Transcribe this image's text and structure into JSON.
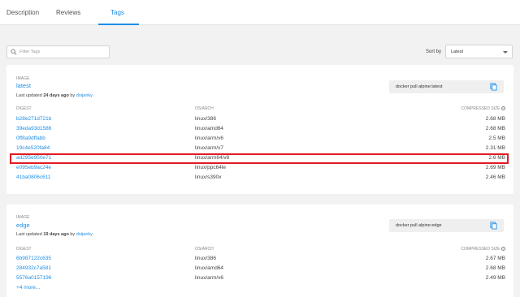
{
  "tabs": [
    {
      "label": "Description"
    },
    {
      "label": "Reviews"
    },
    {
      "label": "Tags"
    }
  ],
  "filter": {
    "placeholder": "Filter Tags",
    "value": ""
  },
  "sort": {
    "label": "Sort by",
    "selected": "Latest"
  },
  "columns": {
    "digest": "DIGEST",
    "os_arch": "OS/ARCH",
    "size": "COMPRESSED SIZE"
  },
  "help_glyph": "?",
  "cards": [
    {
      "image_label": "IMAGE",
      "tag": "latest",
      "updated_prefix": "Last updated",
      "updated_ago": "24 days ago",
      "updated_by": "by",
      "user": "doijanky",
      "pull_command": "docker pull alpine:latest",
      "rows": [
        {
          "digest": "b28e271d721b",
          "arch": "linux/386",
          "size": "2.68 MB"
        },
        {
          "digest": "39eda93d1586",
          "arch": "linux/amd64",
          "size": "2.68 MB"
        },
        {
          "digest": "0ff8a9dffabb",
          "arch": "linux/arm/v6",
          "size": "2.5 MB"
        },
        {
          "digest": "19c4e520fa84",
          "arch": "linux/arm/v7",
          "size": "2.31 MB"
        },
        {
          "digest": "ad295e950e71",
          "arch": "linux/arm64/v8",
          "size": "2.6 MB"
        },
        {
          "digest": "e095eb9ac24e",
          "arch": "linux/ppc64le",
          "size": "2.69 MB"
        },
        {
          "digest": "41ba0806c611",
          "arch": "linux/s390x",
          "size": "2.46 MB"
        }
      ]
    },
    {
      "image_label": "IMAGE",
      "tag": "edge",
      "updated_prefix": "Last updated",
      "updated_ago": "19 days ago",
      "updated_by": "by",
      "user": "doijanky",
      "pull_command": "docker pull alpine:edge",
      "rows": [
        {
          "digest": "6b987122c635",
          "arch": "linux/386",
          "size": "2.67 MB"
        },
        {
          "digest": "284932c7a581",
          "arch": "linux/amd64",
          "size": "2.68 MB"
        },
        {
          "digest": "5576a0157196",
          "arch": "linux/arm/v6",
          "size": "2.49 MB"
        }
      ],
      "more": "+4 more..."
    }
  ],
  "colors": {
    "accent": "#1d8ee7",
    "highlight": "#e11b22",
    "background": "#f2f2f2"
  }
}
